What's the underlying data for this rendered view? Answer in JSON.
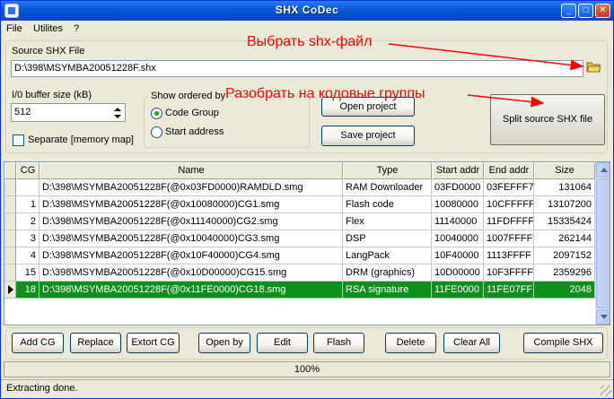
{
  "window": {
    "title": "SHX CoDec",
    "min_glyph": "_",
    "max_glyph": "□",
    "close_glyph": "✕"
  },
  "menu": [
    "File",
    "Utilites",
    "?"
  ],
  "source": {
    "label": "Source SHX File",
    "path": "D:\\398\\MSYMBA20051228F.shx"
  },
  "buffer": {
    "label": "I/0 buffer size (kB)",
    "value": "512"
  },
  "separate": {
    "label": "Separate [memory map]",
    "checked": false
  },
  "show_ordered": {
    "label": "Show ordered by",
    "options": [
      "Code Group",
      "Start address"
    ],
    "selected": "Code Group"
  },
  "buttons": {
    "open_project": "Open project",
    "save_project": "Save project",
    "split": "Split source SHX file"
  },
  "annotations": {
    "select_file": "Выбрать shx-файл",
    "split_groups": "Разобрать на кодовые группы"
  },
  "table": {
    "columns": [
      "CG",
      "Name",
      "Type",
      "Start addr",
      "End addr",
      "Size"
    ],
    "rows": [
      {
        "cg": "",
        "name": "D:\\398\\MSYMBA20051228F(@0x03FD0000)RAMDLD.smg",
        "type": "RAM Downloader",
        "start": "03FD0000",
        "end": "03FEFFF7",
        "size": "131064",
        "selected": false
      },
      {
        "cg": "1",
        "name": "D:\\398\\MSYMBA20051228F(@0x10080000)CG1.smg",
        "type": "Flash code",
        "start": "10080000",
        "end": "10CFFFFF",
        "size": "13107200",
        "selected": false
      },
      {
        "cg": "2",
        "name": "D:\\398\\MSYMBA20051228F(@0x11140000)CG2.smg",
        "type": "Flex",
        "start": "11140000",
        "end": "11FDFFFF",
        "size": "15335424",
        "selected": false
      },
      {
        "cg": "3",
        "name": "D:\\398\\MSYMBA20051228F(@0x10040000)CG3.smg",
        "type": "DSP",
        "start": "10040000",
        "end": "1007FFFF",
        "size": "262144",
        "selected": false
      },
      {
        "cg": "4",
        "name": "D:\\398\\MSYMBA20051228F(@0x10F40000)CG4.smg",
        "type": "LangPack",
        "start": "10F40000",
        "end": "1113FFFF",
        "size": "2097152",
        "selected": false
      },
      {
        "cg": "15",
        "name": "D:\\398\\MSYMBA20051228F(@0x10D00000)CG15.smg",
        "type": "DRM (graphics)",
        "start": "10D00000",
        "end": "10F3FFFF",
        "size": "2359296",
        "selected": false
      },
      {
        "cg": "18",
        "name": "D:\\398\\MSYMBA20051228F(@0x11FE0000)CG18.smg",
        "type": "RSA signature",
        "start": "11FE0000",
        "end": "11FE07FF",
        "size": "2048",
        "selected": true
      }
    ]
  },
  "toolbar": [
    "Add CG",
    "Replace",
    "Extort CG",
    "Open by",
    "Edit",
    "Flash",
    "Delete",
    "Clear All",
    "Compile SHX"
  ],
  "progress": {
    "text": "100%",
    "value": 100
  },
  "status": "Extracting done.",
  "colors": {
    "accent": "#0a5bd8",
    "selected_row": "#0f8f1c",
    "annotation": "#ff0000"
  }
}
